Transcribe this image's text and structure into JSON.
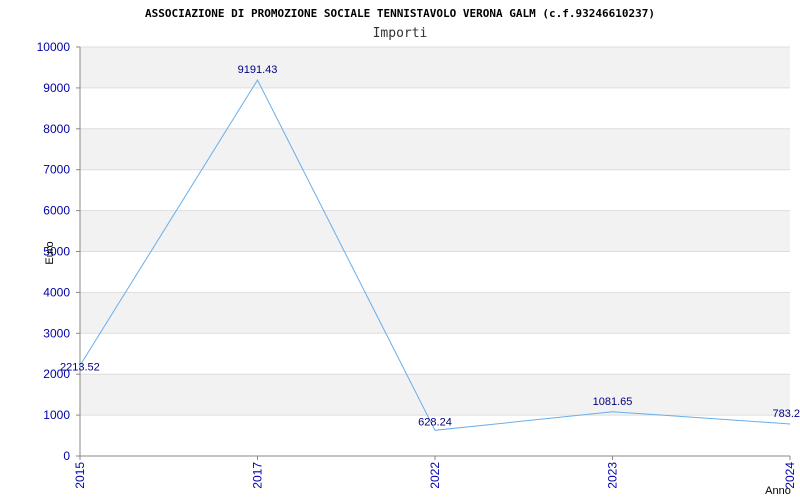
{
  "chart_data": {
    "type": "line",
    "title": "ASSOCIAZIONE DI PROMOZIONE SOCIALE TENNISTAVOLO VERONA GALM (c.f.93246610237)",
    "subtitle": "Importi",
    "xlabel": "Anno",
    "ylabel": "Euro",
    "categories": [
      "2015",
      "2017",
      "2022",
      "2023",
      "2024"
    ],
    "values": [
      2213.52,
      9191.43,
      628.24,
      1081.65,
      783.2
    ],
    "data_labels": [
      "2213.52",
      "9191.43",
      "628.24",
      "1081.65",
      "783.2"
    ],
    "ylim": [
      0,
      10000
    ],
    "yticks": [
      "0",
      "1000",
      "2000",
      "3000",
      "4000",
      "5000",
      "6000",
      "7000",
      "8000",
      "9000",
      "10000"
    ],
    "grid": true,
    "colors": {
      "line": "#6aaee8",
      "band": "#f2f2f2",
      "axis": "#888888",
      "tick_text": "#0000aa",
      "data_label": "#000080"
    }
  }
}
